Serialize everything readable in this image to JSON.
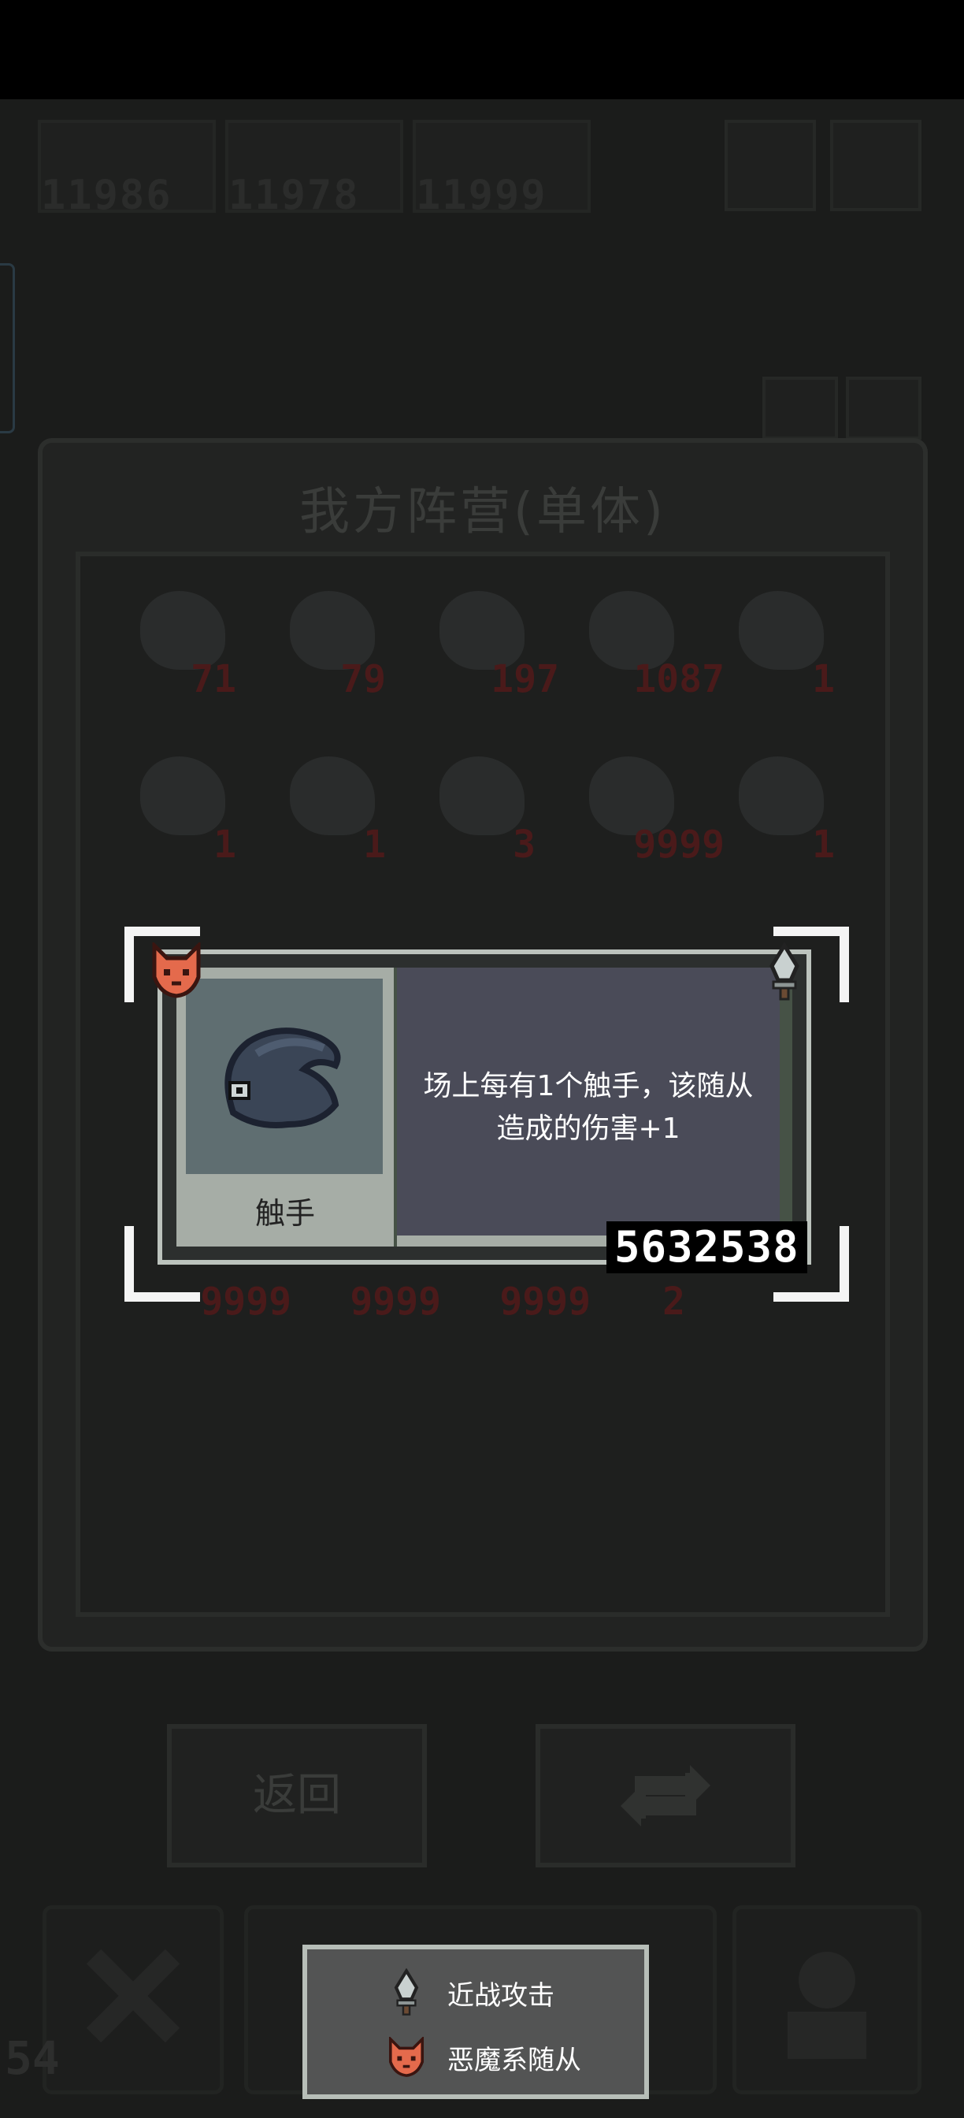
{
  "resources": [
    {
      "value": "11986"
    },
    {
      "value": "11978"
    },
    {
      "value": "11999"
    }
  ],
  "panel": {
    "title": "我方阵营(单体)"
  },
  "roster": {
    "row1": [
      "71",
      "79",
      "197",
      "1087",
      "1"
    ],
    "row2": [
      "1",
      "1",
      "3",
      "9999",
      "1"
    ],
    "row5": [
      "9999",
      "9999",
      "9999",
      "2"
    ]
  },
  "buttons": {
    "back": "返回"
  },
  "dock": {
    "level": "54"
  },
  "card": {
    "name": "触手",
    "description_line1": "场上每有1个触手，该随从",
    "description_line2": "造成的伤害+1",
    "id": "5632538",
    "faction_icon": "demon-fox-icon",
    "type_icon": "melee-sword-icon"
  },
  "legend": {
    "items": [
      {
        "icon": "melee-sword-icon",
        "label": "近战攻击"
      },
      {
        "icon": "demon-fox-icon",
        "label": "恶魔系随从"
      }
    ]
  },
  "colors": {
    "card_border": "#bcc3bd",
    "card_desc_bg": "#4a4b58",
    "card_art_bg": "#5f6e71",
    "demon_icon": "#e46a4c",
    "dim_number_red": "#4a1a1a"
  }
}
